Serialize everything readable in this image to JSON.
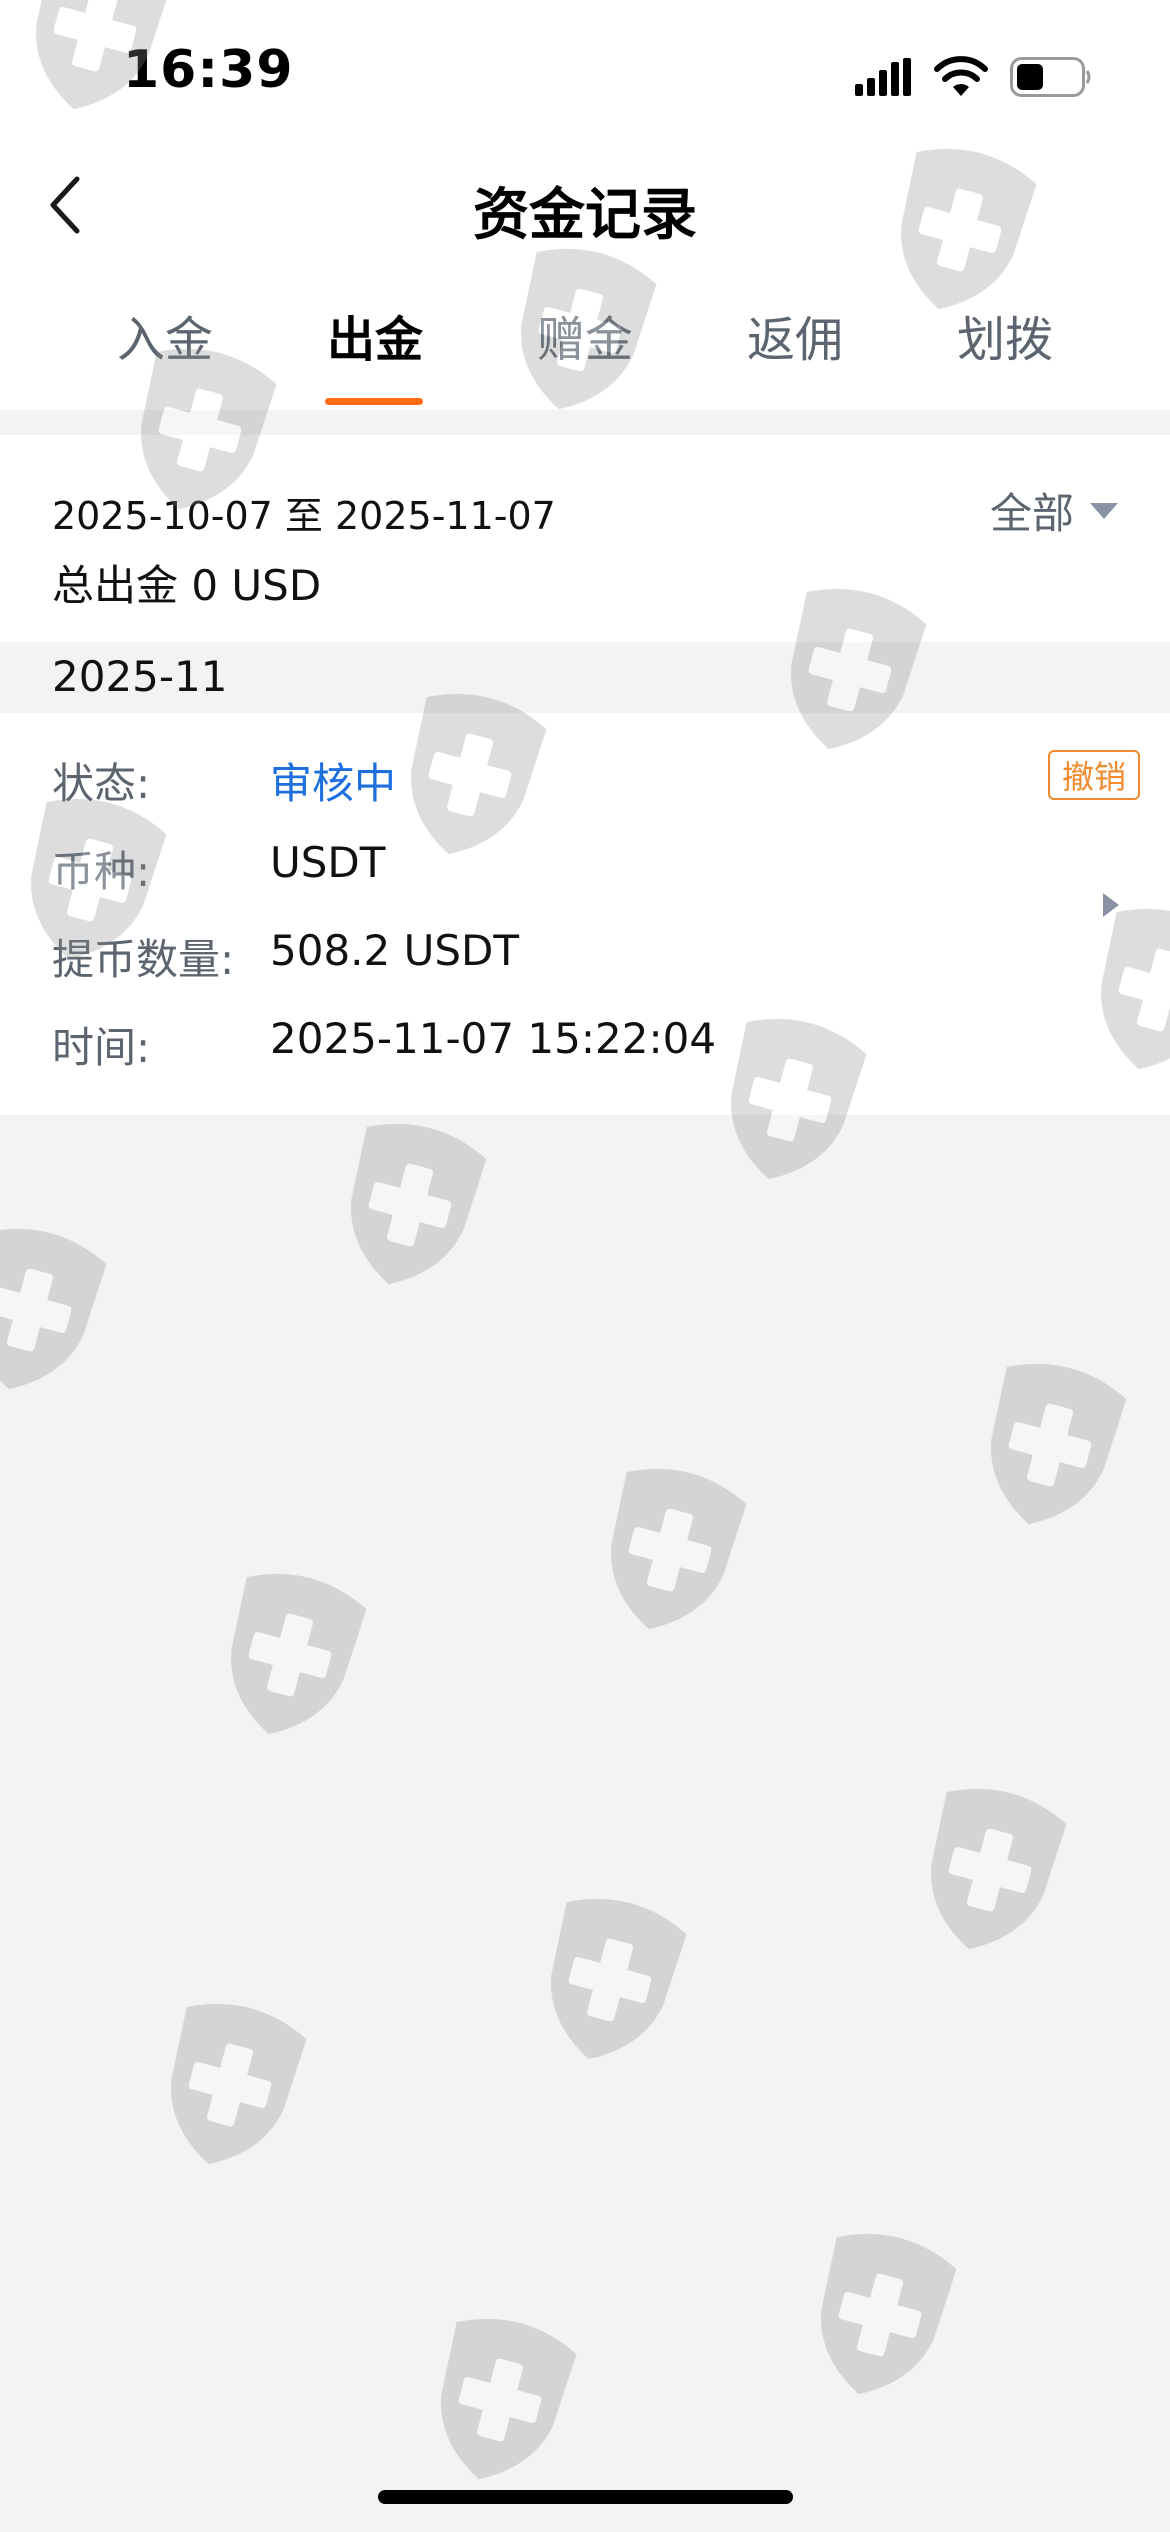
{
  "status_bar": {
    "time": "16:39"
  },
  "header": {
    "title": "资金记录"
  },
  "tabs": [
    {
      "label": "入金",
      "active": false
    },
    {
      "label": "出金",
      "active": true
    },
    {
      "label": "赠金",
      "active": false
    },
    {
      "label": "返佣",
      "active": false
    },
    {
      "label": "划拨",
      "active": false
    }
  ],
  "filter": {
    "date_range": "2025-10-07 至 2025-11-07",
    "total": "总出金 0 USD",
    "dropdown_value": "全部"
  },
  "records": {
    "month": "2025-11",
    "items": [
      {
        "status_label": "状态:",
        "status_value": "审核中",
        "currency_label": "币种:",
        "currency_value": "USDT",
        "amount_label": "提币数量:",
        "amount_value": "508.2 USDT",
        "time_label": "时间:",
        "time_value": "2025-11-07 15:22:04",
        "cancel_label": "撤销"
      }
    ]
  },
  "icons": [
    "chevron-left-icon",
    "signal-icon",
    "wifi-icon",
    "battery-icon",
    "caret-down-icon",
    "caret-right-icon",
    "shield-watermark-icon"
  ],
  "colors": {
    "accent": "#ff6a13",
    "link": "#1d6fe0",
    "cancel": "#f28a2e",
    "muted_text": "#5c6470",
    "background": "#f2f3f5"
  }
}
